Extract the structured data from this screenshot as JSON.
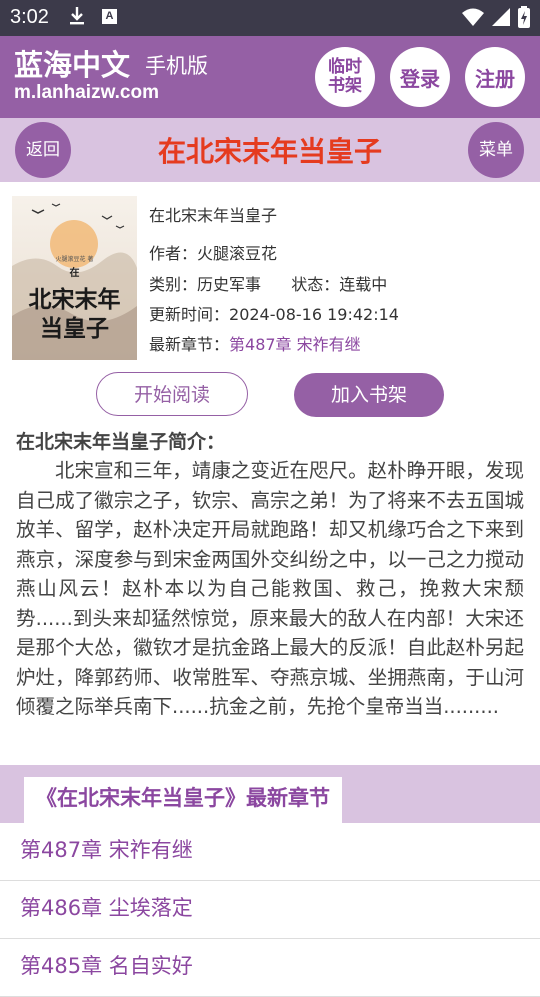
{
  "status": {
    "time": "3:02",
    "notif_a": "A"
  },
  "header": {
    "brand": "蓝海中文",
    "brand_sub": "手机版",
    "domain": "m.lanhaizw.com",
    "temp_shelf_line1": "临时",
    "temp_shelf_line2": "书架",
    "login": "登录",
    "register": "注册"
  },
  "titlebar": {
    "back": "返回",
    "title": "在北宋末年当皇子",
    "menu": "菜单"
  },
  "book": {
    "title": "在北宋末年当皇子",
    "author_label": "作者：",
    "author": "火腿滚豆花",
    "category_label": "类别：",
    "category": "历史军事",
    "state_label": "状态：",
    "state": "连载中",
    "updated_label": "更新时间：",
    "updated": "2024-08-16 19:42:14",
    "latest_label": "最新章节：",
    "latest": "第487章 宋祚有继",
    "cover_small": "火腿滚豆花 著",
    "cover_zai": "在",
    "cover_title1": "北宋末年",
    "cover_title2": "当皇子"
  },
  "actions": {
    "read": "开始阅读",
    "shelf": "加入书架"
  },
  "intro": {
    "heading": "在北宋末年当皇子简介：",
    "text": "北宋宣和三年，靖康之变近在咫尺。赵朴睁开眼，发现自己成了徽宗之子，钦宗、高宗之弟！为了将来不去五国城放羊、留学，赵朴决定开局就跑路！却又机缘巧合之下来到燕京，深度参与到宋金两国外交纠纷之中，以一己之力搅动燕山风云！赵朴本以为自己能救国、救己，挽救大宋颓势......到头来却猛然惊觉，原来最大的敌人在内部！大宋还是那个大怂，徽钦才是抗金路上最大的反派！自此赵朴另起炉灶，降郭药师、收常胜军、夺燕京城、坐拥燕南，于山河倾覆之际举兵南下......抗金之前，先抢个皇帝当当........."
  },
  "latest_section": {
    "tab": "《在北宋末年当皇子》最新章节",
    "chapters": [
      "第487章 宋祚有继",
      "第486章 尘埃落定",
      "第485章 名自实好"
    ]
  },
  "colors": {
    "accent": "#9560a5",
    "band": "#d9c3e0",
    "title_red": "#e53b1f"
  }
}
